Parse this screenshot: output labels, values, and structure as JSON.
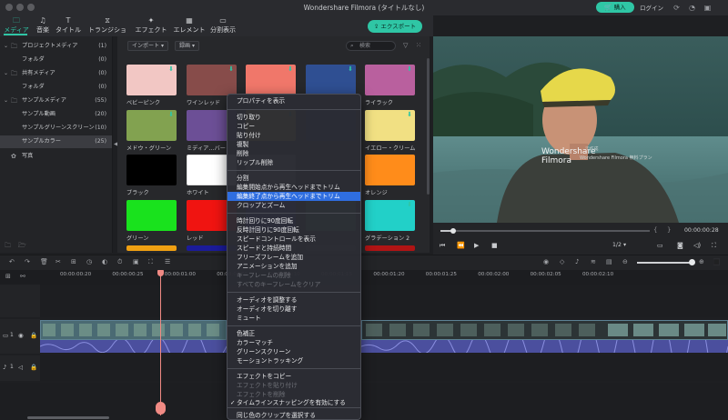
{
  "window": {
    "title": "Wondershare Filmora (タイトルなし)",
    "buy_label": "購入",
    "login_label": "ログイン"
  },
  "toolbar": {
    "tabs": [
      {
        "label": "メディア",
        "icon": "folder-icon"
      },
      {
        "label": "音楽",
        "icon": "music-note-icon"
      },
      {
        "label": "タイトル",
        "icon": "text-icon"
      },
      {
        "label": "トランジション",
        "icon": "transition-icon"
      },
      {
        "label": "エフェクト",
        "icon": "effects-icon"
      },
      {
        "label": "エレメント",
        "icon": "element-icon"
      },
      {
        "label": "分割表示",
        "icon": "split-screen-icon"
      }
    ],
    "active_tab": "メディア",
    "export_label": "エクスポート"
  },
  "sidebar": {
    "items": [
      {
        "label": "プロジェクトメディア",
        "count": "(1)",
        "level": 0,
        "expandable": true
      },
      {
        "label": "フォルダ",
        "count": "(0)",
        "level": 1,
        "expandable": false
      },
      {
        "label": "共有メディア",
        "count": "(0)",
        "level": 0,
        "expandable": true
      },
      {
        "label": "フォルダ",
        "count": "(0)",
        "level": 1,
        "expandable": false
      },
      {
        "label": "サンプルメディア",
        "count": "(55)",
        "level": 0,
        "expandable": true
      },
      {
        "label": "サンプル動画",
        "count": "(20)",
        "level": 1,
        "expandable": false
      },
      {
        "label": "サンプルグリーンスクリーン",
        "count": "(10)",
        "level": 1,
        "expandable": false
      },
      {
        "label": "サンプルカラー",
        "count": "(25)",
        "level": 1,
        "expandable": false,
        "selected": true
      },
      {
        "label": "写真",
        "count": "",
        "level": 0,
        "expandable": false
      }
    ]
  },
  "media": {
    "import_label": "インポート",
    "sort_label": "録画",
    "search_placeholder": "検索",
    "swatches": [
      {
        "label": "ベビーピンク",
        "color": "#f2c7c4",
        "download": true
      },
      {
        "label": "ワインレッド",
        "color": "#874c4a",
        "download": true
      },
      {
        "label": "",
        "color": "#f0776a",
        "download": true
      },
      {
        "label": "",
        "color": "#2f4f92",
        "download": true
      },
      {
        "label": "ライラック",
        "color": "#b9609e",
        "download": true
      },
      {
        "label": "メドウ・グリーン",
        "color": "#82a250",
        "download": true
      },
      {
        "label": "ミディア…バー",
        "color": "#6c4f96",
        "download": false
      },
      {
        "label": "",
        "color": "#c9bd2f",
        "download": true
      },
      {
        "label": "",
        "color": "#0e2e6e",
        "download": false
      },
      {
        "label": "イエロー・クリーム",
        "color": "#f1e083",
        "download": true
      },
      {
        "label": "ブラック",
        "color": "#000000",
        "download": false
      },
      {
        "label": "ホワイト",
        "color": "#ffffff",
        "download": false
      },
      {
        "label": "",
        "color": "#777777",
        "download": false
      },
      {
        "label": "",
        "color": "#333333",
        "download": false
      },
      {
        "label": "オレンジ",
        "color": "#ff8c1a",
        "download": false
      },
      {
        "label": "グリーン",
        "color": "#19e21d",
        "download": false
      },
      {
        "label": "レッド",
        "color": "#f01411",
        "download": false
      },
      {
        "label": "",
        "color": "#2233bb",
        "download": false
      },
      {
        "label": "",
        "color": "#55aa66",
        "download": false
      },
      {
        "label": "グラデーション 2",
        "color": "#22d0c8",
        "download": true
      },
      {
        "label": "",
        "color": "#f0a012",
        "download": false
      },
      {
        "label": "",
        "color": "#1b1b99",
        "download": false
      },
      {
        "label": "",
        "color": "#555555",
        "download": false
      },
      {
        "label": "",
        "color": "#444444",
        "download": false
      },
      {
        "label": "",
        "color": "#b01414",
        "download": false
      }
    ]
  },
  "preview": {
    "watermark_title": "Wondershare",
    "watermark_sub": "Filmora",
    "watermark_tag": "で作成",
    "watermark_note": "Wondershare Filmora 無料プラン",
    "timecode": "00:00:00:28",
    "ratio": "1/2",
    "progress": 0.06
  },
  "timeline": {
    "ruler_times": [
      "00:00:00:20",
      "00:00:00:25",
      "00:00:01:00",
      "00:00:01:05",
      "00:00:01:10",
      "00:00:01:15",
      "00:00:01:20",
      "00:00:01:25",
      "00:00:02:00",
      "00:00:02:05",
      "00:00:02:10"
    ],
    "video_track_label": "1",
    "audio_track_label": "1"
  },
  "context_menu": {
    "items": [
      {
        "label": "プロパティを表示",
        "disabled": false
      },
      {
        "label": "切り取り",
        "disabled": false
      },
      {
        "label": "コピー",
        "disabled": false
      },
      {
        "label": "貼り付け",
        "disabled": false
      },
      {
        "label": "複製",
        "disabled": false
      },
      {
        "label": "削除",
        "disabled": false
      },
      {
        "label": "リップル削除",
        "disabled": false
      },
      {
        "label": "分割",
        "disabled": false
      },
      {
        "label": "編集開始点から再生ヘッドまでトリム",
        "disabled": false
      },
      {
        "label": "編集終了点から再生ヘッドまでトリム",
        "disabled": false,
        "highlighted": true
      },
      {
        "label": "クロップとズーム",
        "disabled": false
      },
      {
        "label": "時計回りに90度回転",
        "disabled": false
      },
      {
        "label": "反時計回りに90度回転",
        "disabled": false
      },
      {
        "label": "スピードコントロールを表示",
        "disabled": false
      },
      {
        "label": "スピードと持続時間",
        "disabled": false
      },
      {
        "label": "フリーズフレームを追加",
        "disabled": false
      },
      {
        "label": "アニメーションを追加",
        "disabled": false
      },
      {
        "label": "キーフレームの削除",
        "disabled": true
      },
      {
        "label": "すべてのキーフレームをクリア",
        "disabled": true
      },
      {
        "label": "オーディオを調整する",
        "disabled": false
      },
      {
        "label": "オーディオを切り離す",
        "disabled": false
      },
      {
        "label": "ミュート",
        "disabled": false
      },
      {
        "label": "色補正",
        "disabled": false
      },
      {
        "label": "カラーマッチ",
        "disabled": false
      },
      {
        "label": "グリーンスクリーン",
        "disabled": false
      },
      {
        "label": "モーショントラッキング",
        "disabled": false
      },
      {
        "label": "エフェクトをコピー",
        "disabled": false
      },
      {
        "label": "エフェクトを貼り付け",
        "disabled": true
      },
      {
        "label": "エフェクトを削除",
        "disabled": true
      },
      {
        "label": "タイムラインスナッピングを有効にする",
        "disabled": false,
        "checked": true
      },
      {
        "label": "同じ色のクリップを選択する",
        "disabled": false
      }
    ]
  },
  "colors": {
    "accent": "#2fc6a5",
    "menu_highlight": "#2f6ee0",
    "playhead": "#f08a84"
  }
}
